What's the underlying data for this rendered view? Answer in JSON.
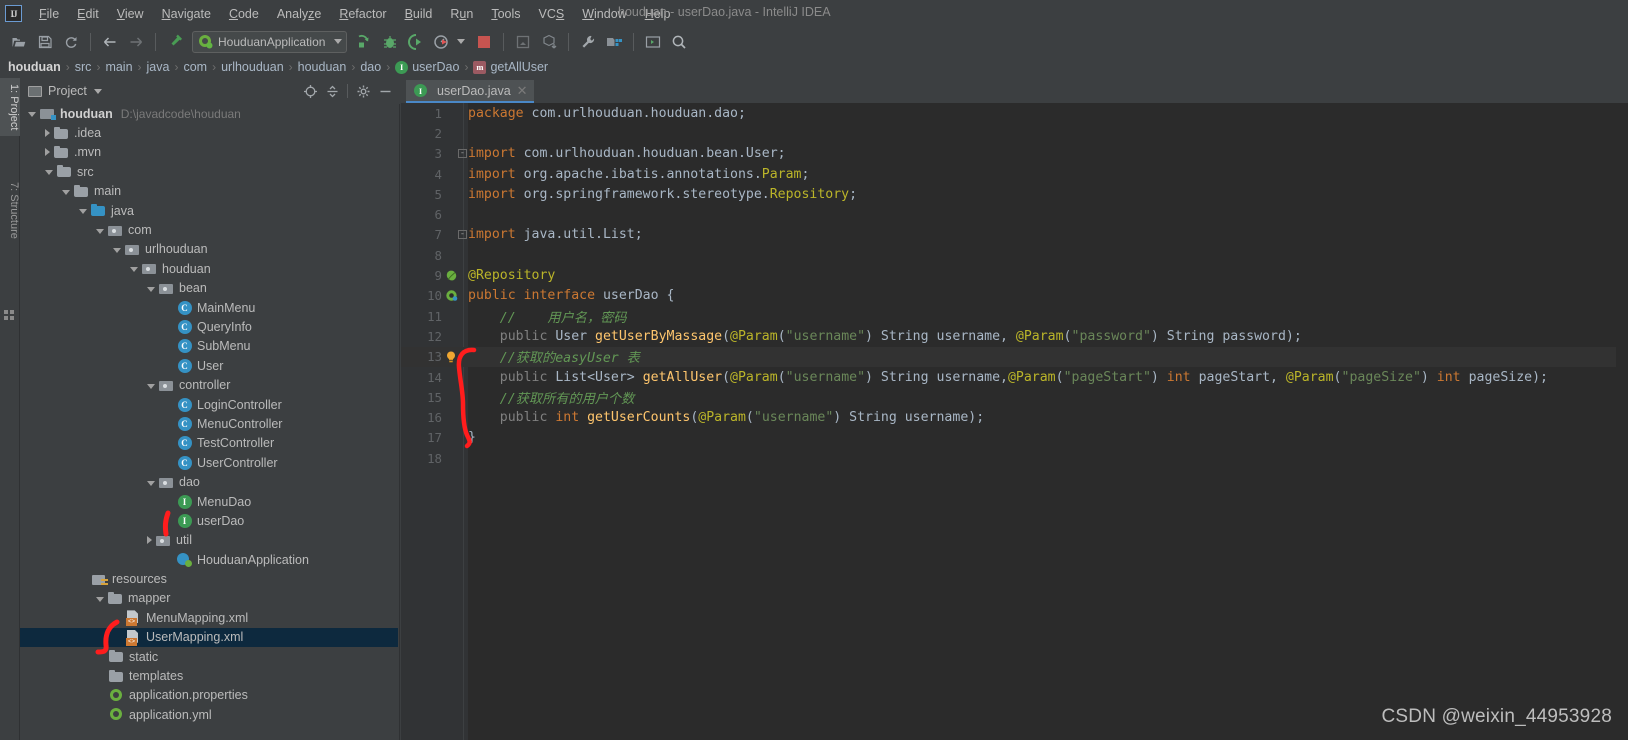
{
  "window": {
    "title": "houduan - userDao.java - IntelliJ IDEA",
    "logo_text": "IJ"
  },
  "menu": {
    "items": [
      {
        "label": "File",
        "mnemonic": "F"
      },
      {
        "label": "Edit",
        "mnemonic": "E"
      },
      {
        "label": "View",
        "mnemonic": "V"
      },
      {
        "label": "Navigate",
        "mnemonic": "N"
      },
      {
        "label": "Code",
        "mnemonic": "C"
      },
      {
        "label": "Analyze",
        "mnemonic": "z"
      },
      {
        "label": "Refactor",
        "mnemonic": "R"
      },
      {
        "label": "Build",
        "mnemonic": "B"
      },
      {
        "label": "Run",
        "mnemonic": "u"
      },
      {
        "label": "Tools",
        "mnemonic": "T"
      },
      {
        "label": "VCS",
        "mnemonic": "S"
      },
      {
        "label": "Window",
        "mnemonic": "W"
      },
      {
        "label": "Help",
        "mnemonic": "H"
      }
    ]
  },
  "toolbar": {
    "icons_left": [
      "open-folder-icon",
      "save-icon",
      "sync-icon"
    ],
    "nav_back_icon": "arrow-left-icon",
    "nav_forward_icon": "arrow-right-icon",
    "build_icon": "hammer-icon",
    "run_config": {
      "name": "HouduanApplication",
      "icon": "spring-boot-icon",
      "dropdown_icon": "chevron-down-icon"
    },
    "icons_run": [
      "run-icon",
      "debug-icon",
      "run-with-coverage-icon",
      "profile-icon"
    ],
    "stop_icon": "stop-icon",
    "icons_vcs": [
      "update-project-icon",
      "commit-icon"
    ],
    "icons_right": [
      "wrench-icon",
      "project-structure-icon",
      "terminal-icon",
      "search-everywhere-icon"
    ]
  },
  "breadcrumb": {
    "segments": [
      {
        "label": "houduan",
        "bold": true,
        "icon": null
      },
      {
        "label": "src",
        "bold": false,
        "icon": null
      },
      {
        "label": "main",
        "bold": false,
        "icon": null
      },
      {
        "label": "java",
        "bold": false,
        "icon": null
      },
      {
        "label": "com",
        "bold": false,
        "icon": null
      },
      {
        "label": "urlhouduan",
        "bold": false,
        "icon": null
      },
      {
        "label": "houduan",
        "bold": false,
        "icon": null
      },
      {
        "label": "dao",
        "bold": false,
        "icon": null
      },
      {
        "label": "userDao",
        "bold": false,
        "icon": "interface-icon",
        "icon_letter": "I"
      },
      {
        "label": "getAllUser",
        "bold": false,
        "icon": "method-icon",
        "icon_letter": "m"
      }
    ],
    "separator": "›"
  },
  "left_rail": {
    "tabs": [
      {
        "label": "1: Project",
        "active": true
      },
      {
        "label": "7: Structure",
        "active": false
      }
    ]
  },
  "project_panel": {
    "title": "Project",
    "window_icon": "project-window-icon",
    "dropdown_icon": "chevron-down-icon",
    "actions": [
      "locate-icon",
      "collapse-all-icon",
      "gear-icon",
      "hide-icon"
    ],
    "tree": [
      {
        "depth": 0,
        "arrow": "open",
        "icon": "module",
        "label": "houduan",
        "bold": true,
        "path": "D:\\javadcode\\houduan"
      },
      {
        "depth": 1,
        "arrow": "closed",
        "icon": "folder",
        "label": ".idea"
      },
      {
        "depth": 1,
        "arrow": "closed",
        "icon": "folder",
        "label": ".mvn"
      },
      {
        "depth": 1,
        "arrow": "open",
        "icon": "folder",
        "label": "src"
      },
      {
        "depth": 2,
        "arrow": "open",
        "icon": "folder",
        "label": "main"
      },
      {
        "depth": 3,
        "arrow": "open",
        "icon": "folder-blue",
        "label": "java"
      },
      {
        "depth": 4,
        "arrow": "open",
        "icon": "package",
        "label": "com"
      },
      {
        "depth": 5,
        "arrow": "open",
        "icon": "package",
        "label": "urlhouduan"
      },
      {
        "depth": 6,
        "arrow": "open",
        "icon": "package",
        "label": "houduan"
      },
      {
        "depth": 7,
        "arrow": "open",
        "icon": "package",
        "label": "bean"
      },
      {
        "depth": 8,
        "arrow": "none",
        "icon": "class",
        "label": "MainMenu"
      },
      {
        "depth": 8,
        "arrow": "none",
        "icon": "class",
        "label": "QueryInfo"
      },
      {
        "depth": 8,
        "arrow": "none",
        "icon": "class",
        "label": "SubMenu"
      },
      {
        "depth": 8,
        "arrow": "none",
        "icon": "class",
        "label": "User"
      },
      {
        "depth": 7,
        "arrow": "open",
        "icon": "package",
        "label": "controller"
      },
      {
        "depth": 8,
        "arrow": "none",
        "icon": "class",
        "label": "LoginController"
      },
      {
        "depth": 8,
        "arrow": "none",
        "icon": "class",
        "label": "MenuController"
      },
      {
        "depth": 8,
        "arrow": "none",
        "icon": "class",
        "label": "TestController"
      },
      {
        "depth": 8,
        "arrow": "none",
        "icon": "class",
        "label": "UserController"
      },
      {
        "depth": 7,
        "arrow": "open",
        "icon": "package",
        "label": "dao"
      },
      {
        "depth": 8,
        "arrow": "none",
        "icon": "interface",
        "label": "MenuDao"
      },
      {
        "depth": 8,
        "arrow": "none",
        "icon": "interface",
        "label": "userDao"
      },
      {
        "depth": 7,
        "arrow": "closed",
        "icon": "package",
        "label": "util"
      },
      {
        "depth": 8,
        "arrow": "none",
        "icon": "app",
        "label": "HouduanApplication"
      },
      {
        "depth": 3,
        "arrow": "none",
        "icon": "resources",
        "label": "resources"
      },
      {
        "depth": 4,
        "arrow": "open",
        "icon": "folder",
        "label": "mapper"
      },
      {
        "depth": 5,
        "arrow": "none",
        "icon": "xml",
        "label": "MenuMapping.xml"
      },
      {
        "depth": 5,
        "arrow": "none",
        "icon": "xml",
        "label": "UserMapping.xml",
        "selected": true
      },
      {
        "depth": 4,
        "arrow": "none",
        "icon": "folder",
        "label": "static"
      },
      {
        "depth": 4,
        "arrow": "none",
        "icon": "folder",
        "label": "templates"
      },
      {
        "depth": 4,
        "arrow": "none",
        "icon": "spring",
        "label": "application.properties"
      },
      {
        "depth": 4,
        "arrow": "none",
        "icon": "spring",
        "label": "application.yml"
      }
    ]
  },
  "editor": {
    "tabs": [
      {
        "label": "userDao.java",
        "icon": "interface-icon",
        "icon_letter": "I",
        "active": true,
        "close_icon": "close-icon"
      }
    ],
    "language": "java",
    "highlighted_line": 13,
    "lines": [
      {
        "no": 1,
        "indent": 0,
        "tokens": [
          {
            "t": "package ",
            "c": "kw"
          },
          {
            "t": "com.urlhouduan.houduan.dao;",
            "c": "pl"
          }
        ]
      },
      {
        "no": 2,
        "indent": 0,
        "tokens": []
      },
      {
        "no": 3,
        "indent": 0,
        "fold": "minus",
        "tokens": [
          {
            "t": "import ",
            "c": "kw"
          },
          {
            "t": "com.urlhouduan.houduan.bean.",
            "c": "pl"
          },
          {
            "t": "User",
            "c": "pl"
          },
          {
            "t": ";",
            "c": "pl"
          }
        ]
      },
      {
        "no": 4,
        "indent": 0,
        "tokens": [
          {
            "t": "import ",
            "c": "kw"
          },
          {
            "t": "org.apache.ibatis.annotations.",
            "c": "pl"
          },
          {
            "t": "Param",
            "c": "ann"
          },
          {
            "t": ";",
            "c": "pl"
          }
        ]
      },
      {
        "no": 5,
        "indent": 0,
        "tokens": [
          {
            "t": "import ",
            "c": "kw"
          },
          {
            "t": "org.springframework.stereotype.",
            "c": "pl"
          },
          {
            "t": "Repository",
            "c": "ann"
          },
          {
            "t": ";",
            "c": "pl"
          }
        ]
      },
      {
        "no": 6,
        "indent": 0,
        "tokens": []
      },
      {
        "no": 7,
        "indent": 0,
        "fold": "minus",
        "tokens": [
          {
            "t": "import ",
            "c": "kw"
          },
          {
            "t": "java.util.List;",
            "c": "pl"
          }
        ]
      },
      {
        "no": 8,
        "indent": 0,
        "tokens": []
      },
      {
        "no": 9,
        "indent": 0,
        "gutter": "bean-icon",
        "tokens": [
          {
            "t": "@Repository",
            "c": "ann"
          }
        ]
      },
      {
        "no": 10,
        "indent": 0,
        "gutter": "spring-bean-icon",
        "tokens": [
          {
            "t": "public ",
            "c": "kw"
          },
          {
            "t": "interface ",
            "c": "kw"
          },
          {
            "t": "userDao ",
            "c": "pl"
          },
          {
            "t": "{",
            "c": "pl"
          }
        ]
      },
      {
        "no": 11,
        "indent": 1,
        "tokens": [
          {
            "t": "//    用户名，密码",
            "c": "cmt"
          }
        ]
      },
      {
        "no": 12,
        "indent": 1,
        "tokens": [
          {
            "t": "public ",
            "c": "dim"
          },
          {
            "t": "User ",
            "c": "pl"
          },
          {
            "t": "getUserByMassage",
            "c": "mth"
          },
          {
            "t": "(",
            "c": "pl"
          },
          {
            "t": "@Param",
            "c": "ann"
          },
          {
            "t": "(",
            "c": "pl"
          },
          {
            "t": "\"username\"",
            "c": "str"
          },
          {
            "t": ") String username, ",
            "c": "pl"
          },
          {
            "t": "@Param",
            "c": "ann"
          },
          {
            "t": "(",
            "c": "pl"
          },
          {
            "t": "\"password\"",
            "c": "str"
          },
          {
            "t": ") String password);",
            "c": "pl"
          }
        ]
      },
      {
        "no": 13,
        "indent": 1,
        "gutter": "intention-bulb-icon",
        "highlight": true,
        "tokens": [
          {
            "t": "//获取的easyUser 表",
            "c": "cmt"
          }
        ]
      },
      {
        "no": 14,
        "indent": 1,
        "tokens": [
          {
            "t": "public ",
            "c": "dim"
          },
          {
            "t": "List<User> ",
            "c": "pl"
          },
          {
            "t": "getAllUser",
            "c": "mth"
          },
          {
            "t": "(",
            "c": "pl"
          },
          {
            "t": "@Param",
            "c": "ann"
          },
          {
            "t": "(",
            "c": "pl"
          },
          {
            "t": "\"username\"",
            "c": "str"
          },
          {
            "t": ") String username,",
            "c": "pl"
          },
          {
            "t": "@Param",
            "c": "ann"
          },
          {
            "t": "(",
            "c": "pl"
          },
          {
            "t": "\"pageStart\"",
            "c": "str"
          },
          {
            "t": ") ",
            "c": "pl"
          },
          {
            "t": "int ",
            "c": "kw"
          },
          {
            "t": "pageStart, ",
            "c": "pl"
          },
          {
            "t": "@Param",
            "c": "ann"
          },
          {
            "t": "(",
            "c": "pl"
          },
          {
            "t": "\"pageSize\"",
            "c": "str"
          },
          {
            "t": ") ",
            "c": "pl"
          },
          {
            "t": "int ",
            "c": "kw"
          },
          {
            "t": "pageSize);",
            "c": "pl"
          }
        ]
      },
      {
        "no": 15,
        "indent": 1,
        "tokens": [
          {
            "t": "//获取所有的用户个数",
            "c": "cmt"
          }
        ]
      },
      {
        "no": 16,
        "indent": 1,
        "tokens": [
          {
            "t": "public ",
            "c": "dim"
          },
          {
            "t": "int ",
            "c": "kw"
          },
          {
            "t": "getUserCounts",
            "c": "mth"
          },
          {
            "t": "(",
            "c": "pl"
          },
          {
            "t": "@Param",
            "c": "ann"
          },
          {
            "t": "(",
            "c": "pl"
          },
          {
            "t": "\"username\"",
            "c": "str"
          },
          {
            "t": ") String username);",
            "c": "pl"
          }
        ]
      },
      {
        "no": 17,
        "indent": 0,
        "tokens": [
          {
            "t": "}",
            "c": "pl"
          }
        ]
      },
      {
        "no": 18,
        "indent": 0,
        "tokens": []
      }
    ]
  },
  "annotations": {
    "color": "#ff1a1a",
    "marks": [
      "bracket-near-userdao-tree-item",
      "bracket-near-usermapping-tree-item",
      "bracket-around-code-lines-13-17"
    ]
  },
  "watermark": {
    "text": "CSDN @weixin_44953928"
  }
}
